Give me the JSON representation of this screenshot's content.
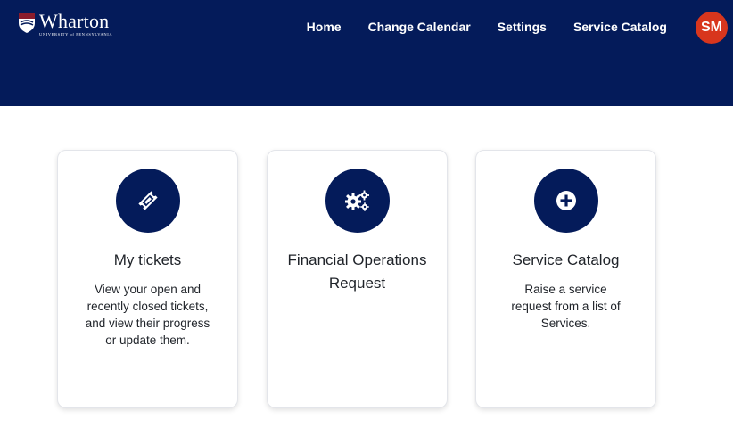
{
  "brand": {
    "name": "Wharton",
    "subtitle": "UNIVERSITY of PENNSYLVANIA"
  },
  "nav": {
    "items": [
      {
        "label": "Home"
      },
      {
        "label": "Change Calendar"
      },
      {
        "label": "Settings"
      },
      {
        "label": "Service Catalog"
      }
    ]
  },
  "user": {
    "initials": "SM"
  },
  "cards": [
    {
      "icon": "ticket-icon",
      "title": "My tickets",
      "description": "View your open and recently closed tickets, and view their progress or update them."
    },
    {
      "icon": "gears-icon",
      "title": "Financial Operations Request",
      "description": ""
    },
    {
      "icon": "plus-circle-icon",
      "title": "Service Catalog",
      "description": "Raise a service request from a list of Services."
    }
  ],
  "colors": {
    "header_bg": "#041b5a",
    "avatar_bg": "#d8361d",
    "icon_circle": "#041b5a"
  }
}
